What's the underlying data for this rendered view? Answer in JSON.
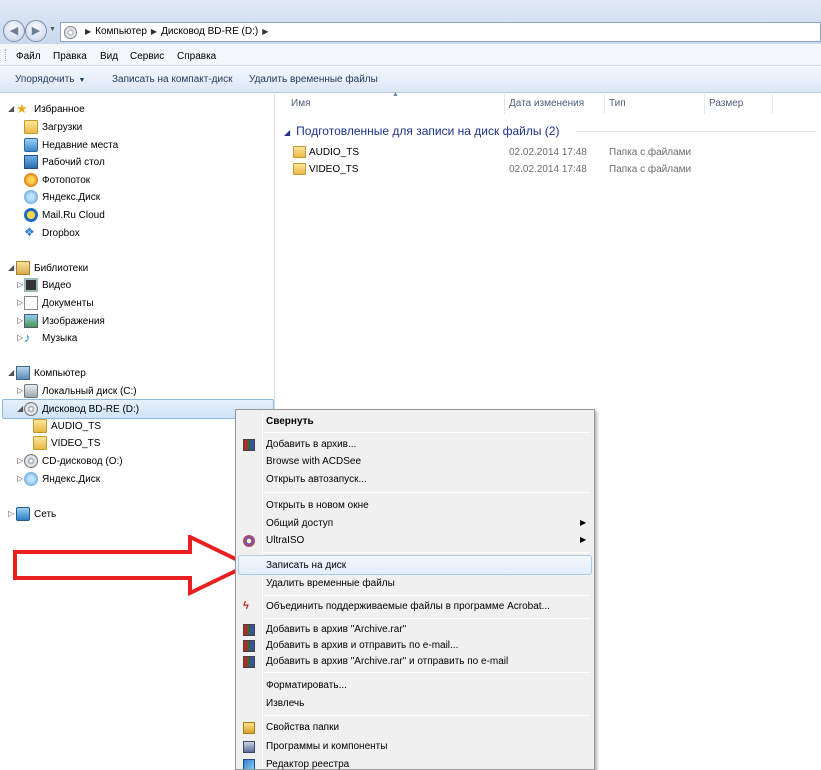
{
  "address": {
    "crumbs": [
      "Компьютер",
      "Дисковод BD-RE (D:)"
    ]
  },
  "menubar": [
    "Файл",
    "Правка",
    "Вид",
    "Сервис",
    "Справка"
  ],
  "commands": {
    "organize": "Упорядочить",
    "burn": "Записать на компакт-диск",
    "delete_temp": "Удалить временные файлы"
  },
  "nav": {
    "favorites": "Избранное",
    "downloads": "Загрузки",
    "recent": "Недавние места",
    "desktop": "Рабочий стол",
    "photostream": "Фотопоток",
    "yandex": "Яндекс.Диск",
    "mailru": "Mail.Ru Cloud",
    "dropbox": "Dropbox",
    "libraries": "Библиотеки",
    "video": "Видео",
    "docs": "Документы",
    "images": "Изображения",
    "music": "Музыка",
    "computer": "Компьютер",
    "local_c": "Локальный диск (C:)",
    "bd_re": "Дисковод BD-RE (D:)",
    "audio_ts": "AUDIO_TS",
    "video_ts": "VIDEO_TS",
    "cd_o": "CD-дисковод (O:)",
    "yandex2": "Яндекс.Диск",
    "network": "Сеть"
  },
  "columns": {
    "name": "Имя",
    "date": "Дата изменения",
    "type": "Тип",
    "size": "Размер"
  },
  "group": {
    "title": "Подготовленные для записи на диск файлы (2)"
  },
  "files": [
    {
      "name": "AUDIO_TS",
      "date": "02.02.2014 17:48",
      "type": "Папка с файлами"
    },
    {
      "name": "VIDEO_TS",
      "date": "02.02.2014 17:48",
      "type": "Папка с файлами"
    }
  ],
  "context_menu": {
    "collapse": "Свернуть",
    "add_archive": "Добавить в архив...",
    "acdsee": "Browse with ACDSee",
    "autoplay": "Открыть автозапуск...",
    "open_new": "Открыть в новом окне",
    "share": "Общий доступ",
    "ultraiso": "UltraISO",
    "burn": "Записать на диск",
    "delete_temp": "Удалить временные файлы",
    "acrobat": "Объединить поддерживаемые файлы в программе Acrobat...",
    "add_rar": "Добавить в архив \"Archive.rar\"",
    "add_email": "Добавить в архив и отправить по e-mail...",
    "add_rar_email": "Добавить в архив \"Archive.rar\" и отправить по e-mail",
    "format": "Форматировать...",
    "eject": "Извлечь",
    "folder_props": "Свойства папки",
    "programs": "Программы и компоненты",
    "regedit": "Редактор реестра"
  }
}
